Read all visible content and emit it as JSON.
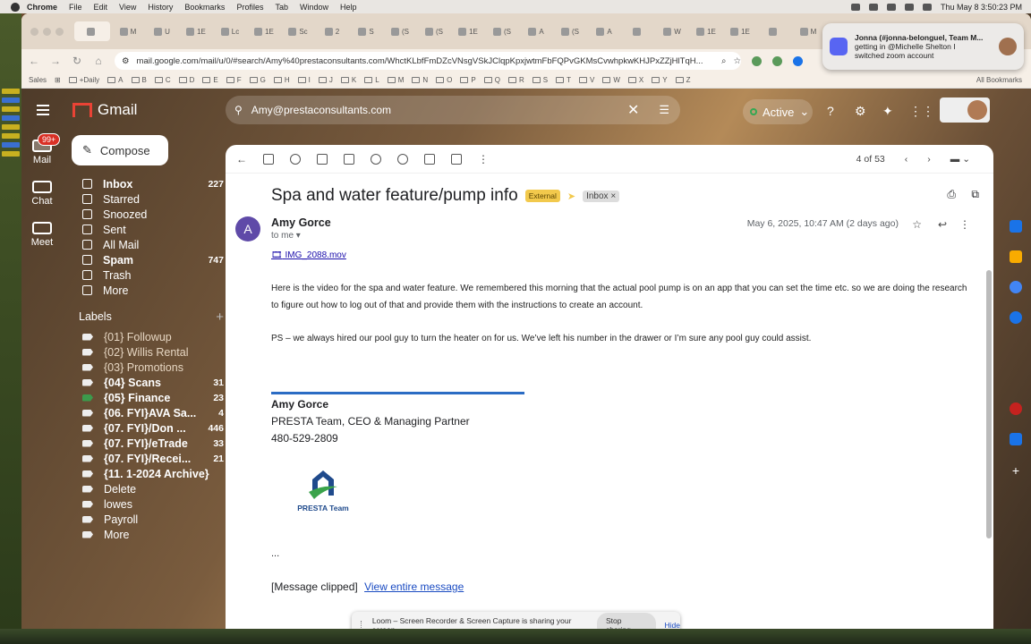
{
  "menubar": {
    "app": "Chrome",
    "items": [
      "File",
      "Edit",
      "View",
      "History",
      "Bookmarks",
      "Profiles",
      "Tab",
      "Window",
      "Help"
    ],
    "clock": "Thu May 8  3:50:23 PM"
  },
  "browser": {
    "url": "mail.google.com/mail/u/0/#search/Amy%40prestaconsultants.com/WhctKLbfFmDZcVNsgVSkJClqpKpxjwtmFbFQPvGKMsCvwhpkwKHJPxZZjHlTqH...",
    "tabs": [
      "",
      "M",
      "U",
      "1E",
      "Lc",
      "1E",
      "Sc",
      "2",
      "S",
      "(S",
      "(S",
      "1E",
      "(S",
      "A",
      "(S",
      "A",
      "",
      "W",
      "1E",
      "1E",
      "",
      "M",
      "P",
      "M",
      "P"
    ],
    "bookmarks": [
      "+Daily",
      "A",
      "B",
      "C",
      "D",
      "E",
      "F",
      "G",
      "H",
      "I",
      "J",
      "K",
      "L",
      "M",
      "N",
      "O",
      "P",
      "Q",
      "R",
      "S",
      "T",
      "V",
      "W",
      "X",
      "Y",
      "Z"
    ],
    "bookmarks_lead": "Sales",
    "all_bookmarks": "All Bookmarks"
  },
  "notification": {
    "title": "Jonna (#jonna-belonguel, Team M...",
    "line1": "getting in @Michelle Shelton I",
    "line2": "switched zoom account"
  },
  "gmail": {
    "brand": "Gmail",
    "search_value": "Amy@prestaconsultants.com",
    "status": "Active",
    "rail": [
      {
        "label": "Mail",
        "badge": "99+"
      },
      {
        "label": "Chat"
      },
      {
        "label": "Meet"
      }
    ],
    "compose": "Compose",
    "folders": [
      {
        "label": "Inbox",
        "count": "227",
        "bold": true
      },
      {
        "label": "Starred",
        "count": ""
      },
      {
        "label": "Snoozed",
        "count": ""
      },
      {
        "label": "Sent",
        "count": ""
      },
      {
        "label": "All Mail",
        "count": ""
      },
      {
        "label": "Spam",
        "count": "747",
        "bold": true
      },
      {
        "label": "Trash",
        "count": ""
      },
      {
        "label": "More",
        "count": ""
      }
    ],
    "labels_heading": "Labels",
    "labels": [
      {
        "label": "{01} Followup",
        "count": ""
      },
      {
        "label": "{02} Willis Rental",
        "count": ""
      },
      {
        "label": "{03} Promotions",
        "count": ""
      },
      {
        "label": "{04} Scans",
        "count": "31",
        "bold": true
      },
      {
        "label": "{05} Finance",
        "count": "23",
        "bold": true
      },
      {
        "label": "{06. FYI}AVA Sa...",
        "count": "4",
        "bold": true
      },
      {
        "label": "{07. FYI}/Don ...",
        "count": "446",
        "bold": true
      },
      {
        "label": "{07. FYI}/eTrade",
        "count": "33",
        "bold": true
      },
      {
        "label": "{07. FYI}/Recei...",
        "count": "21",
        "bold": true
      },
      {
        "label": "{11. 1-2024 Archive}",
        "count": "",
        "bold": true
      },
      {
        "label": "Delete",
        "count": ""
      },
      {
        "label": "lowes",
        "count": ""
      },
      {
        "label": "Payroll",
        "count": ""
      },
      {
        "label": "More",
        "count": ""
      }
    ],
    "pager": "4 of 53",
    "email": {
      "subject": "Spa and water feature/pump info",
      "external": "External",
      "inbox_chip": "Inbox",
      "avatar_letter": "A",
      "sender": "Amy Gorce",
      "to": "to me",
      "date": "May 6, 2025, 10:47 AM (2 days ago)",
      "attachment": "IMG_2088.mov",
      "para1": "Here is the video for the spa and water feature.  We remembered this morning that the actual pool pump is on an app that you can set the time etc. so we are doing the research to figure out how to log out of that and provide them with the instructions to create an account.",
      "para2": "PS – we always hired our pool guy to turn the heater on for us.   We’ve left his number in the drawer or I’m sure any pool guy could assist.",
      "sig_name": "Amy Gorce",
      "sig_title": "PRESTA Team, CEO & Managing Partner",
      "sig_phone": "480-529-2809",
      "sig_logo_text": "PRESTA Team",
      "ellipsis": "...",
      "clipped": "[Message clipped]",
      "view_entire": "View entire message"
    }
  },
  "loom": {
    "text": "Loom – Screen Recorder & Screen Capture is sharing your screen.",
    "stop": "Stop sharing",
    "hide": "Hide"
  }
}
